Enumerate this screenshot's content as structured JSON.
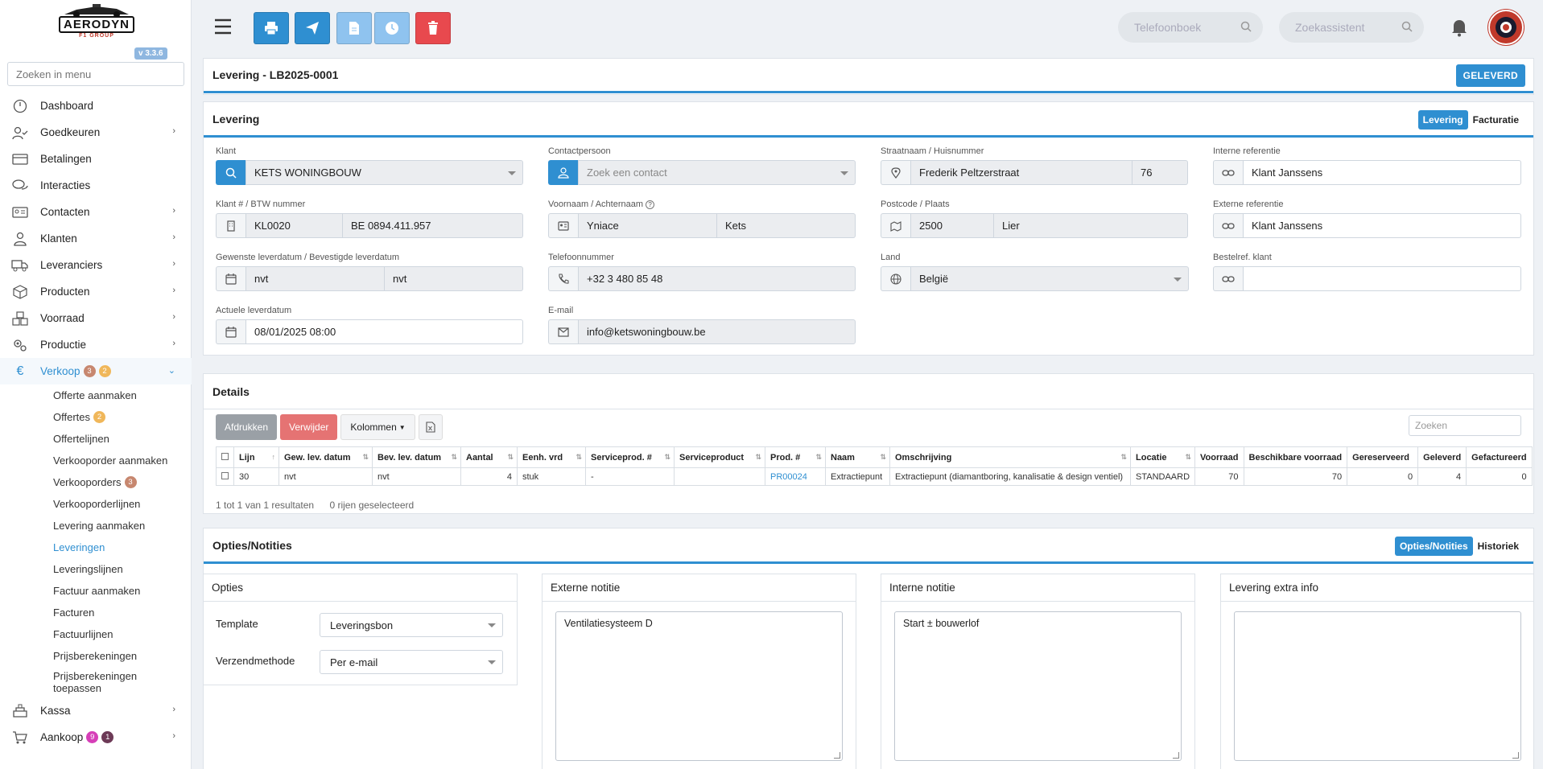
{
  "app": {
    "version": "v 3.3.6",
    "logo_text": "AERODYN",
    "logo_sub": "F1 GROUP"
  },
  "sidebar": {
    "search_placeholder": "Zoeken in menu",
    "items": [
      {
        "label": "Dashboard",
        "icon": "dashboard-icon"
      },
      {
        "label": "Goedkeuren",
        "icon": "user-check-icon",
        "chevron": true
      },
      {
        "label": "Betalingen",
        "icon": "credit-card-icon"
      },
      {
        "label": "Interacties",
        "icon": "chat-icon"
      },
      {
        "label": "Contacten",
        "icon": "contact-card-icon",
        "chevron": true
      },
      {
        "label": "Klanten",
        "icon": "user-icon",
        "chevron": true
      },
      {
        "label": "Leveranciers",
        "icon": "truck-icon",
        "chevron": true
      },
      {
        "label": "Producten",
        "icon": "box-icon",
        "chevron": true
      },
      {
        "label": "Voorraad",
        "icon": "boxes-icon",
        "chevron": true
      },
      {
        "label": "Productie",
        "icon": "gears-icon",
        "chevron": true
      }
    ],
    "verkoop": {
      "label": "Verkoop",
      "badge1": "3",
      "badge2": "2"
    },
    "verkoop_sub": [
      {
        "label": "Offerte aanmaken"
      },
      {
        "label": "Offertes",
        "badge": "2"
      },
      {
        "label": "Offertelijnen"
      },
      {
        "label": "Verkooporder aanmaken"
      },
      {
        "label": "Verkooporders",
        "badge": "3"
      },
      {
        "label": "Verkooporderlijnen"
      },
      {
        "label": "Levering aanmaken"
      },
      {
        "label": "Leveringen"
      },
      {
        "label": "Leveringslijnen"
      },
      {
        "label": "Factuur aanmaken"
      },
      {
        "label": "Facturen"
      },
      {
        "label": "Factuurlijnen"
      },
      {
        "label": "Prijsberekeningen"
      },
      {
        "label": "Prijsberekeningen toepassen"
      }
    ],
    "kassa": {
      "label": "Kassa"
    },
    "aankoop": {
      "label": "Aankoop",
      "badge1": "9",
      "badge2": "1"
    }
  },
  "topbar": {
    "search1_placeholder": "Telefoonboek",
    "search2_placeholder": "Zoekassistent",
    "colors": {
      "primary": "#2f8fd1",
      "light": "#8fc3ef",
      "danger": "#e8494e"
    }
  },
  "header": {
    "title": "Levering - LB2025-0001",
    "status": "GELEVERD"
  },
  "levering": {
    "title": "Levering",
    "tabs": [
      "Levering",
      "Facturatie"
    ],
    "klant_label": "Klant",
    "klant_value": "KETS WONINGBOUW",
    "contact_label": "Contactpersoon",
    "contact_placeholder": "Zoek een contact",
    "straat_label": "Straatnaam / Huisnummer",
    "straat_value": "Frederik Peltzerstraat",
    "huisnr_value": "76",
    "intref_label": "Interne referentie",
    "intref_value": "Klant Janssens",
    "klantnr_label": "Klant # / BTW nummer",
    "klantnr_value": "KL0020",
    "btw_value": "BE 0894.411.957",
    "naam_label": "Voornaam / Achternaam",
    "voornaam_value": "Yniace",
    "achternaam_value": "Kets",
    "postcode_label": "Postcode / Plaats",
    "postcode_value": "2500",
    "plaats_value": "Lier",
    "extref_label": "Externe referentie",
    "extref_value": "Klant Janssens",
    "gewenst_label": "Gewenste leverdatum / Bevestigde leverdatum",
    "gewenst_value": "nvt",
    "bevestigd_value": "nvt",
    "tel_label": "Telefoonnummer",
    "tel_value": "+32 3 480 85 48",
    "land_label": "Land",
    "land_value": "België",
    "bestelref_label": "Bestelref. klant",
    "bestelref_value": "",
    "actueel_label": "Actuele leverdatum",
    "actueel_value": "08/01/2025 08:00",
    "email_label": "E-mail",
    "email_value": "info@ketswoningbouw.be"
  },
  "details": {
    "title": "Details",
    "buttons": {
      "print": "Afdrukken",
      "delete": "Verwijder",
      "columns": "Kolommen"
    },
    "search_placeholder": "Zoeken",
    "columns": [
      "Lijn",
      "Gew. lev. datum",
      "Bev. lev. datum",
      "Aantal",
      "Eenh. vrd",
      "Serviceprod. #",
      "Serviceproduct",
      "Prod. #",
      "Naam",
      "Omschrijving",
      "Locatie",
      "Voorraad",
      "Beschikbare voorraad",
      "Gereserveerd",
      "Geleverd",
      "Gefactureerd"
    ],
    "rows": [
      [
        "30",
        "nvt",
        "nvt",
        "4",
        "stuk",
        "-",
        "",
        "PR00024",
        "Extractiepunt",
        "Extractiepunt (diamantboring, kanalisatie & design ventiel)",
        "STANDAARD",
        "70",
        "70",
        "0",
        "4",
        "0"
      ]
    ],
    "info": "1 tot 1 van 1 resultaten",
    "selected": "0 rijen geselecteerd"
  },
  "opties": {
    "title": "Opties/Notities",
    "tabs": [
      "Opties/Notities",
      "Historiek"
    ],
    "opties_title": "Opties",
    "template_label": "Template",
    "template_value": "Leveringsbon",
    "verzend_label": "Verzendmethode",
    "verzend_value": "Per e-mail",
    "extern_title": "Externe notitie",
    "extern_value": "Ventilatiesysteem D",
    "intern_title": "Interne notitie",
    "intern_value": "Start ± bouwerlof",
    "extra_title": "Levering extra info",
    "extra_value": ""
  }
}
